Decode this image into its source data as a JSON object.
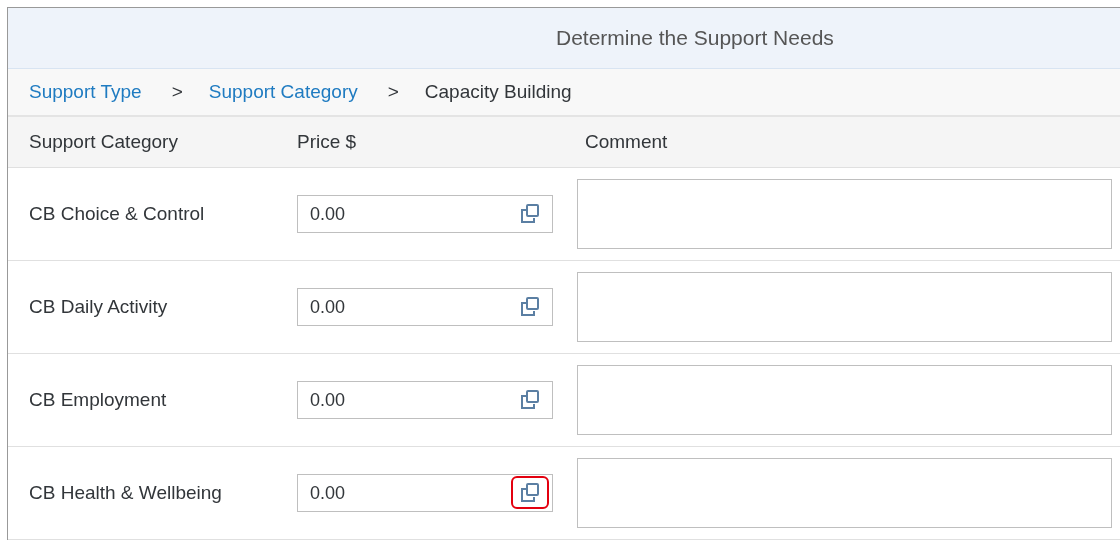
{
  "header": {
    "title": "Determine the Support Needs"
  },
  "breadcrumb": [
    {
      "label": "Support Type",
      "kind": "link"
    },
    {
      "label": ">",
      "kind": "separator"
    },
    {
      "label": "Support Category",
      "kind": "link"
    },
    {
      "label": ">",
      "kind": "separator"
    },
    {
      "label": "Capacity Building",
      "kind": "current"
    }
  ],
  "table": {
    "columns": [
      "Support Category",
      "Price $",
      "Comment"
    ],
    "rows": [
      {
        "category": "CB Choice & Control",
        "price": "0.00",
        "highlighted": false
      },
      {
        "category": "CB Daily Activity",
        "price": "0.00",
        "highlighted": false
      },
      {
        "category": "CB Employment",
        "price": "0.00",
        "highlighted": false
      },
      {
        "category": "CB Health & Wellbeing",
        "price": "0.00",
        "highlighted": true
      }
    ]
  }
}
